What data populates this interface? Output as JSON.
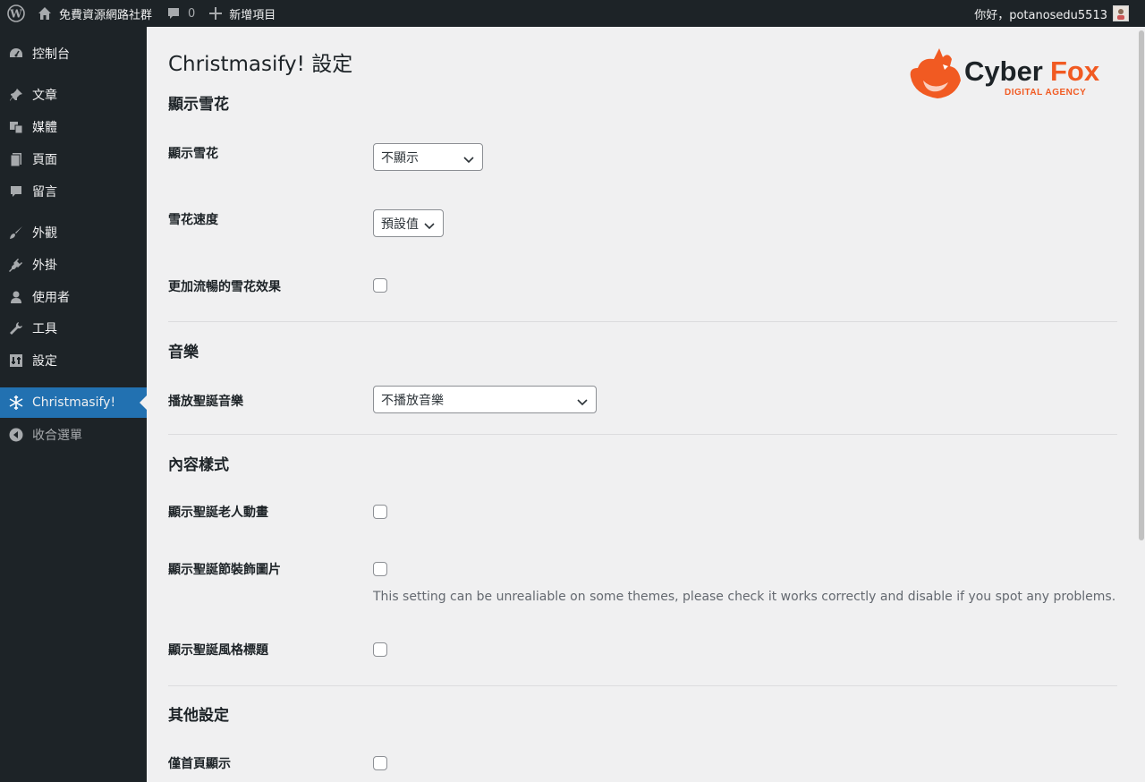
{
  "adminbar": {
    "site_name": "免費資源網路社群",
    "comment_count": "0",
    "new_label": "新增項目",
    "greeting": "你好，potanosedu5513"
  },
  "sidebar": {
    "items": [
      {
        "label": "控制台",
        "icon": "dashboard-icon"
      },
      {
        "label": "文章",
        "icon": "pin-icon"
      },
      {
        "label": "媒體",
        "icon": "media-icon"
      },
      {
        "label": "頁面",
        "icon": "page-icon"
      },
      {
        "label": "留言",
        "icon": "comment-icon"
      },
      {
        "label": "外觀",
        "icon": "brush-icon"
      },
      {
        "label": "外掛",
        "icon": "plugin-icon"
      },
      {
        "label": "使用者",
        "icon": "user-icon"
      },
      {
        "label": "工具",
        "icon": "wrench-icon"
      },
      {
        "label": "設定",
        "icon": "settings-icon"
      },
      {
        "label": "Christmasify!",
        "icon": "snowflake-icon"
      },
      {
        "label": "收合選單",
        "icon": "collapse-icon"
      }
    ],
    "active_color": "#2271b1"
  },
  "page": {
    "title": "Christmasify! 設定",
    "logo": {
      "main": "CyberFox",
      "sub": "DIGITAL AGENCY",
      "accent": "#f15a22"
    }
  },
  "sections": {
    "snow": {
      "title": "顯示雪花",
      "show_label": "顯示雪花",
      "show_value": "不顯示",
      "speed_label": "雪花速度",
      "speed_value": "預設值",
      "smooth_label": "更加流暢的雪花效果"
    },
    "music": {
      "title": "音樂",
      "play_label": "播放聖誕音樂",
      "play_value": "不播放音樂"
    },
    "content": {
      "title": "內容樣式",
      "santa_label": "顯示聖誕老人動畫",
      "decor_label": "顯示聖誕節裝飾圖片",
      "decor_desc": "This setting can be unrealiable on some themes, please check it works correctly and disable if you spot any problems.",
      "heading_label": "顯示聖誕風格標題"
    },
    "other": {
      "title": "其他設定",
      "homepage_label": "僅首頁顯示"
    }
  }
}
